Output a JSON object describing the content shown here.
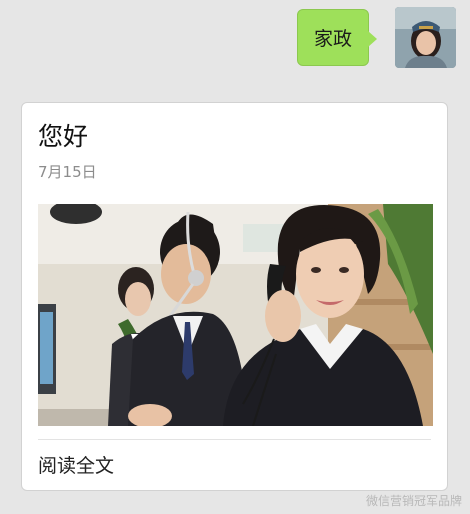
{
  "chat": {
    "outgoing_message": "家政",
    "avatar_icon": "user-avatar-icon"
  },
  "article_card": {
    "title": "您好",
    "date": "7月15日",
    "image_subject": "customer-service-team-photo",
    "read_more_label": "阅读全文"
  },
  "watermark": "微信营销冠军品牌",
  "colors": {
    "background": "#e6e6e6",
    "bubble": "#9ee05a",
    "card": "#ffffff",
    "date_text": "#8c8c8c"
  }
}
